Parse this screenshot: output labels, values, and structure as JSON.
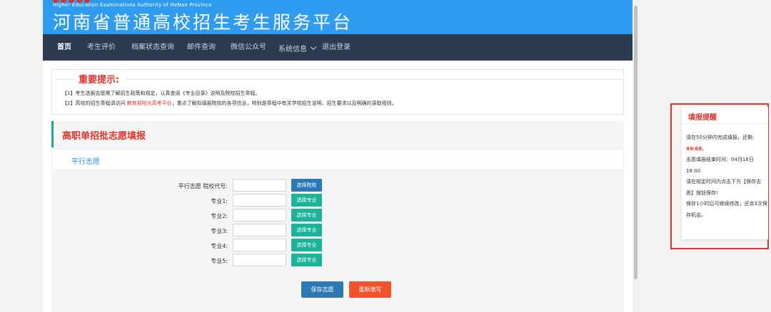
{
  "header": {
    "authority_en": "Higher Education Examinations Authority of HeNan Province",
    "title": "河南省普通高校招生考生服务平台"
  },
  "nav": {
    "items": [
      "首页",
      "考生评价",
      "档案状态查询",
      "邮件查询",
      "微信公众号",
      "系统信息",
      "退出登录"
    ]
  },
  "notice": {
    "title": "重要提示:",
    "line1": "【1】考生选报志愿需了解招生政策和规定，认真查阅《专业目录》说明及院校招生章程。",
    "line2_prefix": "【2】高校的招生章程请访问 ",
    "line2_link": "教育部阳光高考平台",
    "line2_suffix": "，重点了解拟填报院校的各项信息，特别是章程中有关学校招生说明、招生要求以及明确的录取规则。"
  },
  "form": {
    "section_title": "高职单招批志愿填报",
    "sub_title": "平行志愿",
    "school_label": "平行志愿 院校代号:",
    "choose_school": "选择院校",
    "majors": [
      {
        "label": "专业1:",
        "button": "选择专业"
      },
      {
        "label": "专业2:",
        "button": "选择专业"
      },
      {
        "label": "专业3:",
        "button": "选择专业"
      },
      {
        "label": "专业4:",
        "button": "选择专业"
      },
      {
        "label": "专业5:",
        "button": "选择专业"
      }
    ],
    "save": "保存志愿",
    "reset": "重新填写"
  },
  "reminder": {
    "title": "填报提醒",
    "line1": "请在50分钟内完成填报，还剩:",
    "countdown": "49:68",
    "countdown_suffix": "。",
    "line2": "志愿填报结束时间：04月16日18:00",
    "line3": "请在规定时间内点击下方【保存志愿】按钮保存!",
    "line4": "保存1小时后可继续修改，还余3次保存机会。"
  },
  "colors": {
    "banner": "#2f9cf0",
    "nav": "#2b3a4f",
    "accent_red": "#e2332b",
    "button_blue": "#2b78b5",
    "button_teal": "#1bb49a",
    "button_orange": "#f0522e"
  }
}
